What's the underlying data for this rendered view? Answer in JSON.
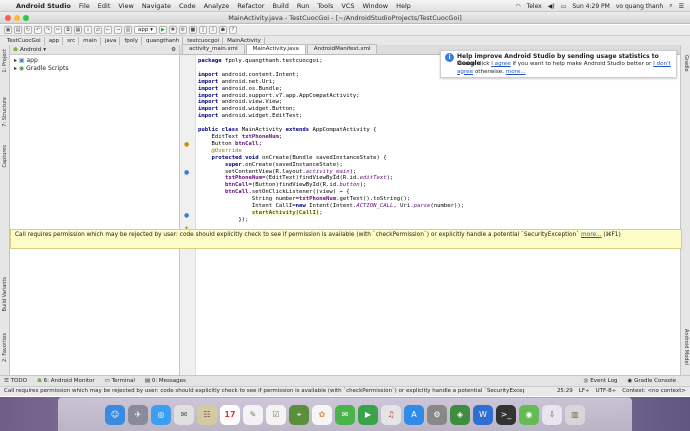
{
  "menubar": {
    "app": "Android Studio",
    "items": [
      "File",
      "Edit",
      "View",
      "Navigate",
      "Code",
      "Analyze",
      "Refactor",
      "Build",
      "Run",
      "Tools",
      "VCS",
      "Window",
      "Help"
    ],
    "input_source": "Telex",
    "clock": "Sun 4:29 PM",
    "user": "vo quang thanh"
  },
  "window": {
    "title": "MainActivity.java - TestCuocGoi - [~/AndroidStudioProjects/TestCuocGoi]"
  },
  "toolbar": {
    "run_config": "app"
  },
  "breadcrumbs": [
    "TestCuocGoi",
    "app",
    "src",
    "main",
    "java",
    "fpoly",
    "quangthanh",
    "testcuocgoi",
    "MainActivity"
  ],
  "left_strip": {
    "tabs": [
      "1: Project",
      "7: Structure",
      "Captures",
      "Build Variants",
      "2: Favorites"
    ]
  },
  "right_strip": {
    "tabs": [
      "Gradle",
      "Android Model"
    ]
  },
  "project": {
    "view_label": "Android",
    "tree": [
      "app",
      "Gradle Scripts"
    ]
  },
  "editor": {
    "tabs": [
      "activity_main.xml",
      "MainActivity.java",
      "AndroidManifest.xml"
    ],
    "active_tab": "MainActivity.java"
  },
  "notification": {
    "title": "Help improve Android Studio by sending usage statistics to Google",
    "line1_pre": "Please click ",
    "agree": "I agree",
    "line1_post": " if you want to help make Android Studio better or ",
    "dont_agree": "I don't agree",
    "line2_post": " otherwise. ",
    "more": "more..."
  },
  "tooltip": {
    "text": "Call requires permission which may be rejected by user: code should explicitly check to see if permission is available (with `checkPermission`) or explicitly handle a potential `SecurityException`",
    "more": "more...",
    "shortcut": "(⌘F1)"
  },
  "bottom_tabs": [
    "TODO",
    "6: Android Monitor",
    "Terminal",
    "0: Messages",
    "Event Log",
    "Gradle Console"
  ],
  "status": {
    "message": "Call requires permission which may be rejected by user: code should explicitly check to see if permission is available (with `checkPermission`) or explicitly handle a potential `SecurityException`",
    "position": "25:29",
    "line_sep": "LF÷",
    "encoding": "UTF-8÷",
    "context": "Context: <no context>"
  },
  "dock": {
    "badge_calendar": "17"
  },
  "colors": {
    "keyword": "#000080",
    "field": "#660e7a",
    "annotation": "#808000",
    "tooltip_bg": "#fdfbc6",
    "link": "#2255cc"
  }
}
